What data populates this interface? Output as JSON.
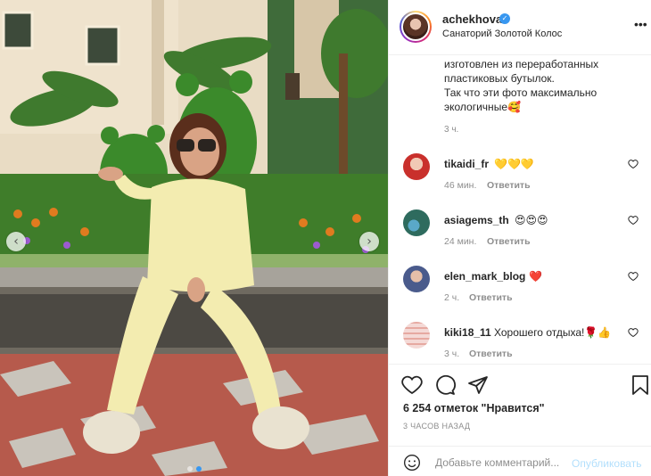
{
  "post": {
    "username": "achekhova",
    "verified_icon": "verified-badge-icon",
    "location": "Санаторий Золотой Колос",
    "more_icon": "more-options-icon",
    "more_glyph": "•••"
  },
  "photo": {
    "prev_glyph": "‹",
    "next_glyph": "›",
    "dots_total": 2,
    "active_dot": 1
  },
  "caption": {
    "lines": [
      "изготовлен из переработанных",
      "пластиковых бутылок.",
      "Так что эти фото максимально",
      "экологичные"
    ],
    "emoji": "🥰",
    "time": "3 ч."
  },
  "comments": [
    {
      "user": "tikaidi_fr",
      "text": "💛💛💛",
      "time": "46 мин.",
      "reply": "Ответить",
      "avatar_color": "#c9302c"
    },
    {
      "user": "asiagems_th",
      "text": "😍😍😍",
      "time": "24 мин.",
      "reply": "Ответить",
      "avatar_color": "#2e6b5e"
    },
    {
      "user": "elen_mark_blog",
      "text": "❤️",
      "time": "2 ч.",
      "reply": "Ответить",
      "avatar_color": "#4a5b8c"
    },
    {
      "user": "kiki18_11",
      "text": "Хорошего отдыха!🌹👍",
      "time": "3 ч.",
      "reply": "Ответить",
      "avatar_color": "#f4d9d6"
    }
  ],
  "actions": {
    "like_icon": "heart-outline-icon",
    "comment_icon": "comment-bubble-icon",
    "share_icon": "paper-plane-icon",
    "save_icon": "bookmark-icon"
  },
  "likes_text": "6 254 отметок \"Нравится\"",
  "post_time": "3 ЧАСОВ НАЗАД",
  "add_comment": {
    "placeholder": "Добавьте комментарий...",
    "publish": "Опубликовать"
  },
  "colors": {
    "accent": "#3897f0",
    "publish_disabled": "#b2dffc",
    "muted": "#8e8e8e",
    "border": "#efefef"
  }
}
